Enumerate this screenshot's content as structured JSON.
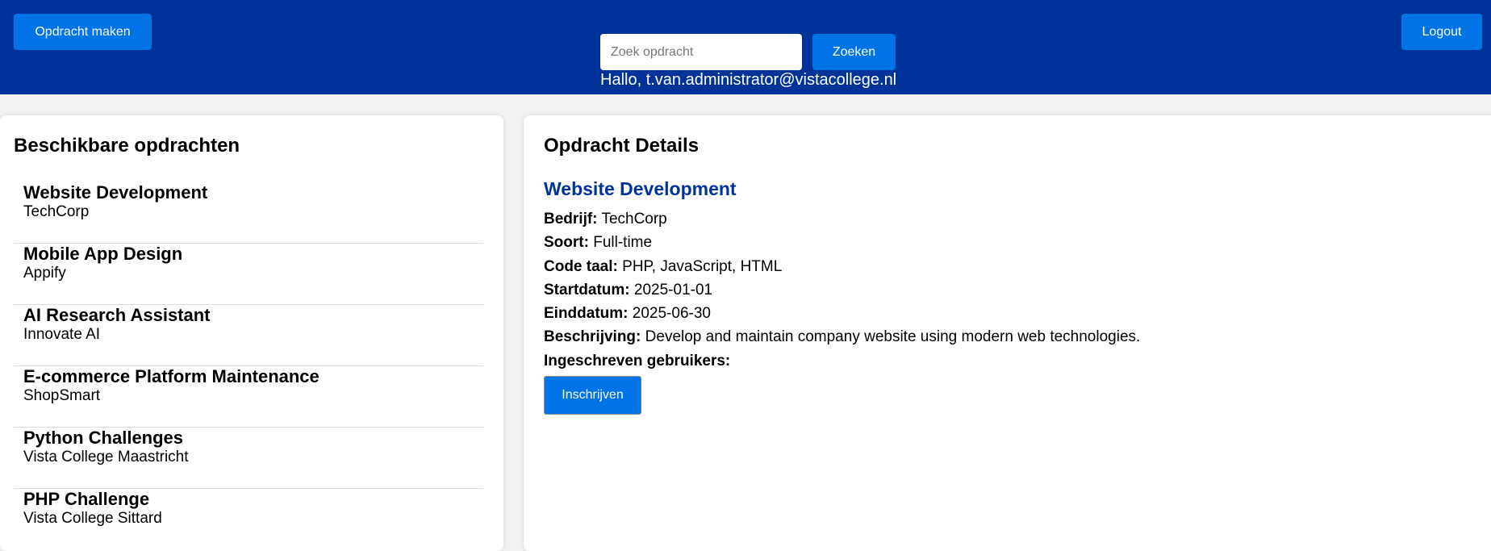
{
  "header": {
    "create_button": "Opdracht maken",
    "search_placeholder": "Zoek opdracht",
    "search_value": "",
    "search_button": "Zoeken",
    "greeting": "Hallo, t.van.administrator@vistacollege.nl",
    "logout_button": "Logout"
  },
  "list_panel": {
    "title": "Beschikbare opdrachten",
    "items": [
      {
        "title": "Website Development",
        "company": "TechCorp"
      },
      {
        "title": "Mobile App Design",
        "company": "Appify"
      },
      {
        "title": "AI Research Assistant",
        "company": "Innovate AI"
      },
      {
        "title": "E-commerce Platform Maintenance",
        "company": "ShopSmart"
      },
      {
        "title": "Python Challenges",
        "company": "Vista College Maastricht"
      },
      {
        "title": "PHP Challenge",
        "company": "Vista College Sittard"
      }
    ]
  },
  "detail_panel": {
    "title": "Opdracht Details",
    "job_title": "Website Development",
    "fields": [
      {
        "label": "Bedrijf:",
        "value": "TechCorp"
      },
      {
        "label": "Soort:",
        "value": "Full-time"
      },
      {
        "label": "Code taal:",
        "value": "PHP, JavaScript, HTML"
      },
      {
        "label": "Startdatum:",
        "value": "2025-01-01"
      },
      {
        "label": "Einddatum:",
        "value": "2025-06-30"
      },
      {
        "label": "Beschrijving:",
        "value": "Develop and maintain company website using modern web technologies."
      },
      {
        "label": "Ingeschreven gebruikers:",
        "value": ""
      }
    ],
    "enroll_button": "Inschrijven"
  },
  "colors": {
    "header_bg": "#00339a",
    "button_bg": "#0073e6",
    "page_bg": "#f2f2f2",
    "accent_title": "#00339a"
  }
}
